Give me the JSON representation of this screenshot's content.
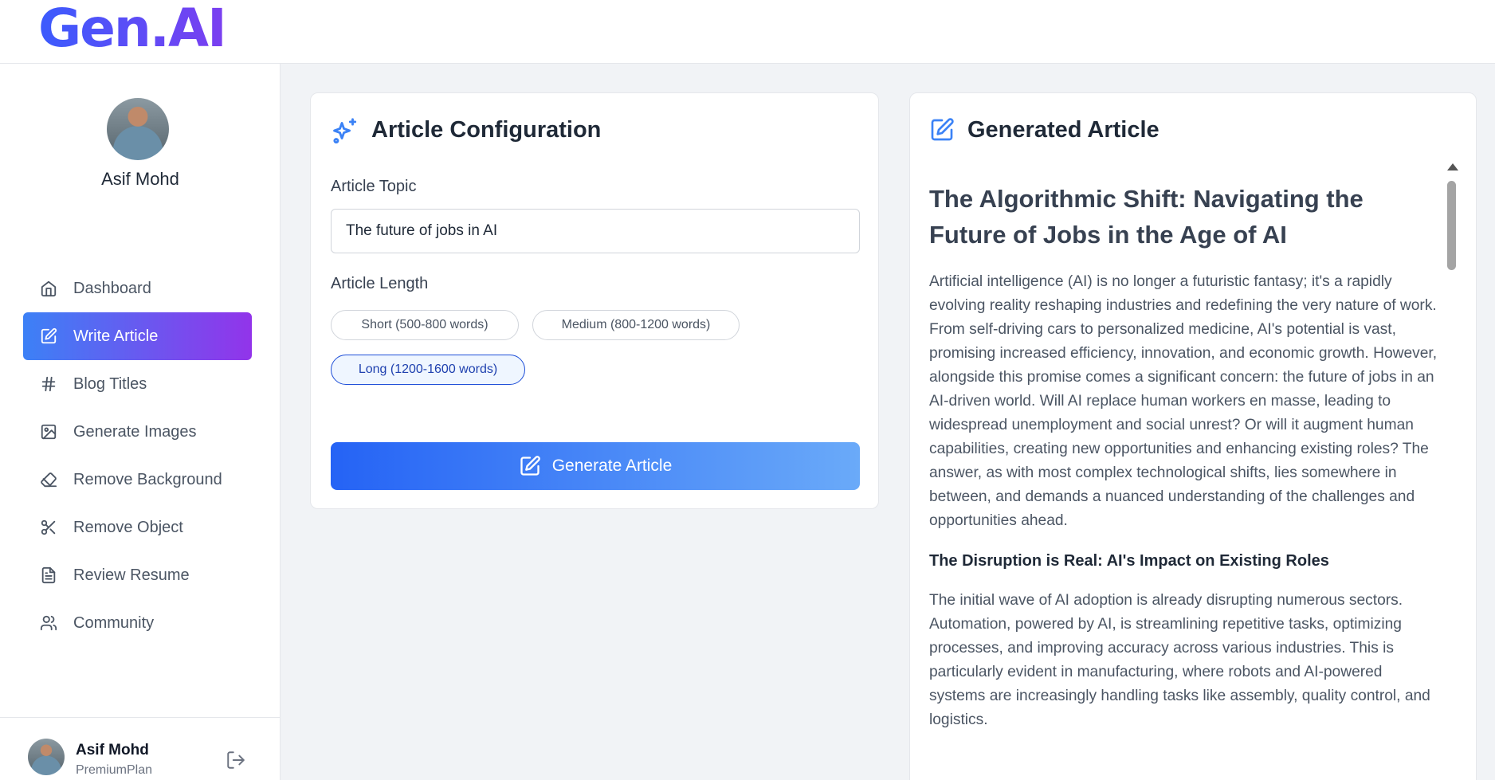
{
  "app": {
    "logo": "Gen.AI"
  },
  "user": {
    "name": "Asif Mohd",
    "plan": "PremiumPlan"
  },
  "nav": [
    {
      "label": "Dashboard",
      "icon": "home-icon"
    },
    {
      "label": "Write Article",
      "icon": "edit-icon",
      "active": true
    },
    {
      "label": "Blog Titles",
      "icon": "hash-icon"
    },
    {
      "label": "Generate Images",
      "icon": "image-icon"
    },
    {
      "label": "Remove Background",
      "icon": "eraser-icon"
    },
    {
      "label": "Remove Object",
      "icon": "scissors-icon"
    },
    {
      "label": "Review Resume",
      "icon": "file-text-icon"
    },
    {
      "label": "Community",
      "icon": "users-icon"
    }
  ],
  "config": {
    "title": "Article Configuration",
    "topic_label": "Article Topic",
    "topic_value": "The future of jobs in AI",
    "length_label": "Article Length",
    "lengths": [
      {
        "label": "Short (500-800 words)",
        "selected": false
      },
      {
        "label": "Medium (800-1200 words)",
        "selected": false
      },
      {
        "label": "Long (1200-1600 words)",
        "selected": true
      }
    ],
    "generate_label": "Generate Article"
  },
  "article": {
    "panel_title": "Generated Article",
    "heading": "The Algorithmic Shift: Navigating the Future of Jobs in the Age of AI",
    "intro": "Artificial intelligence (AI) is no longer a futuristic fantasy; it's a rapidly evolving reality reshaping industries and redefining the very nature of work. From self-driving cars to personalized medicine, AI's potential is vast, promising increased efficiency, innovation, and economic growth. However, alongside this promise comes a significant concern: the future of jobs in an AI-driven world. Will AI replace human workers en masse, leading to widespread unemployment and social unrest? Or will it augment human capabilities, creating new opportunities and enhancing existing roles? The answer, as with most complex technological shifts, lies somewhere in between, and demands a nuanced understanding of the challenges and opportunities ahead.",
    "section1_heading": "The Disruption is Real: AI's Impact on Existing Roles",
    "section1_body": "The initial wave of AI adoption is already disrupting numerous sectors. Automation, powered by AI, is streamlining repetitive tasks, optimizing processes, and improving accuracy across various industries. This is particularly evident in manufacturing, where robots and AI-powered systems are increasingly handling tasks like assembly, quality control, and logistics."
  },
  "colors": {
    "accent_start": "#3c81f6",
    "accent_end": "#9234ea",
    "button_start": "#2563f5",
    "button_end": "#6aaaf9"
  }
}
